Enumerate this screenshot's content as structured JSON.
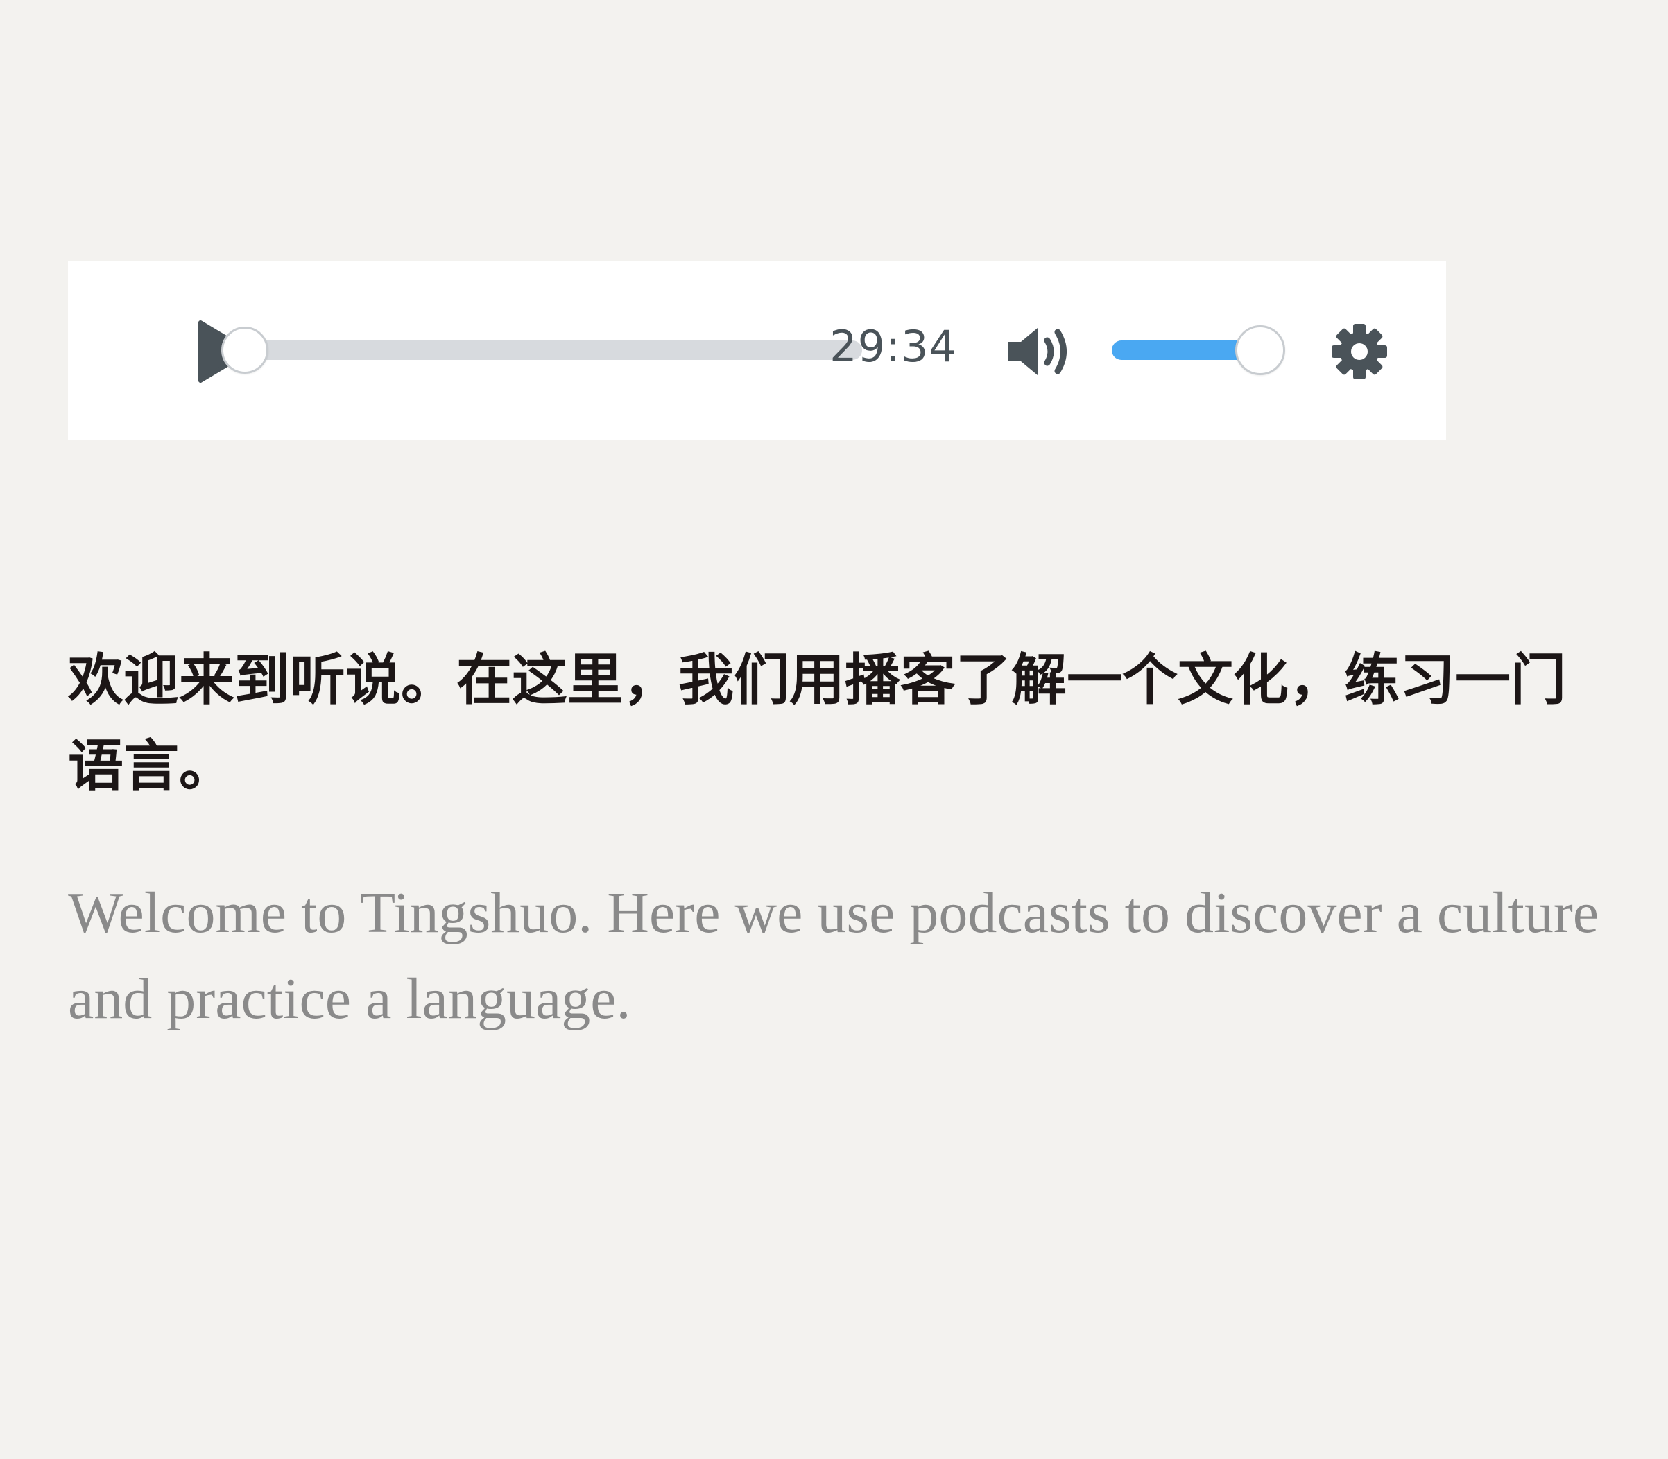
{
  "player": {
    "duration": "29:34",
    "progress": 0.0,
    "volume": 0.95,
    "icons": {
      "play": "play-icon",
      "volume": "volume-high-icon",
      "settings": "gear-icon"
    },
    "colors": {
      "accent": "#4aa8f2",
      "icon": "#4a5359",
      "track": "#d7dade"
    }
  },
  "content": {
    "chinese": "欢迎来到听说。在这里，我们用播客了解一个文化，练习一门语言。",
    "english": "Welcome to Tingshuo. Here we use podcasts to discover a culture and practice a language."
  }
}
